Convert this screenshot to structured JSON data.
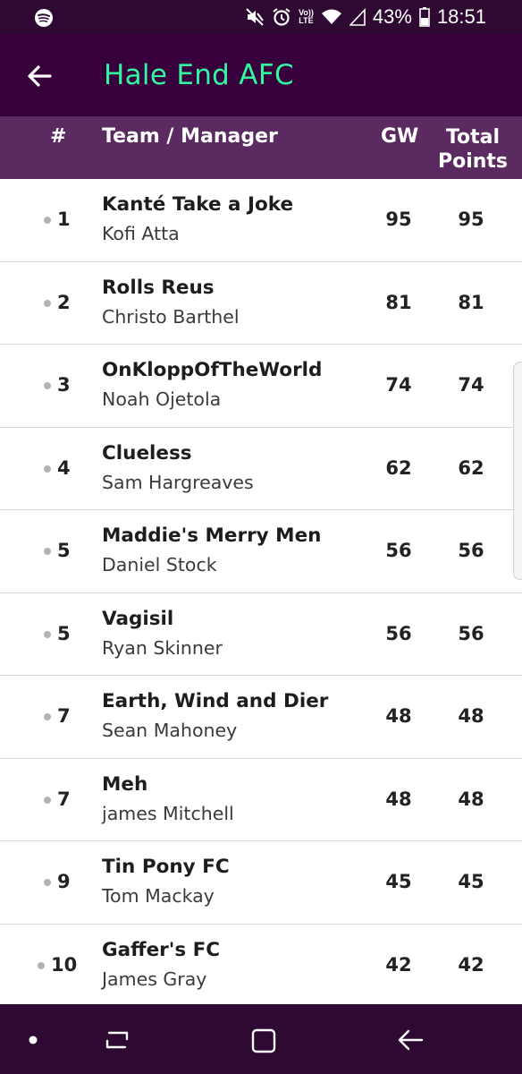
{
  "status_bar": {
    "battery": "43%",
    "time": "18:51",
    "volte_top": "Vo))",
    "volte_bottom": "LTE",
    "icons": [
      "spotify-icon",
      "mute-icon",
      "alarm-icon",
      "volte-icon",
      "wifi-icon",
      "signal-icon",
      "battery-icon"
    ]
  },
  "app_bar": {
    "title": "Hale End AFC",
    "title_color": "#34f5a0",
    "background": "#37003c"
  },
  "table_header": {
    "rank": "#",
    "team_manager": "Team / Manager",
    "gw": "GW",
    "total_line1": "Total",
    "total_line2": "Points"
  },
  "rows": [
    {
      "rank": "1",
      "team": "Kanté Take a Joke",
      "manager": "Kofi Atta",
      "gw": "95",
      "total": "95"
    },
    {
      "rank": "2",
      "team": "Rolls Reus",
      "manager": "Christo Barthel",
      "gw": "81",
      "total": "81"
    },
    {
      "rank": "3",
      "team": "OnKloppOfTheWorld",
      "manager": "Noah Ojetola",
      "gw": "74",
      "total": "74"
    },
    {
      "rank": "4",
      "team": "Clueless",
      "manager": "Sam Hargreaves",
      "gw": "62",
      "total": "62"
    },
    {
      "rank": "5",
      "team": "Maddie's Merry Men",
      "manager": "Daniel Stock",
      "gw": "56",
      "total": "56"
    },
    {
      "rank": "5",
      "team": "Vagisil",
      "manager": "Ryan Skinner",
      "gw": "56",
      "total": "56"
    },
    {
      "rank": "7",
      "team": "Earth, Wind and Dier",
      "manager": "Sean Mahoney",
      "gw": "48",
      "total": "48"
    },
    {
      "rank": "7",
      "team": "Meh",
      "manager": "james Mitchell",
      "gw": "48",
      "total": "48"
    },
    {
      "rank": "9",
      "team": "Tin Pony FC",
      "manager": "Tom Mackay",
      "gw": "45",
      "total": "45"
    },
    {
      "rank": "10",
      "team": "Gaffer's FC",
      "manager": "James Gray",
      "gw": "42",
      "total": "42"
    }
  ],
  "nav_bar": {
    "icons": [
      "home-dot-icon",
      "recent-apps-icon",
      "home-icon",
      "back-icon"
    ]
  }
}
